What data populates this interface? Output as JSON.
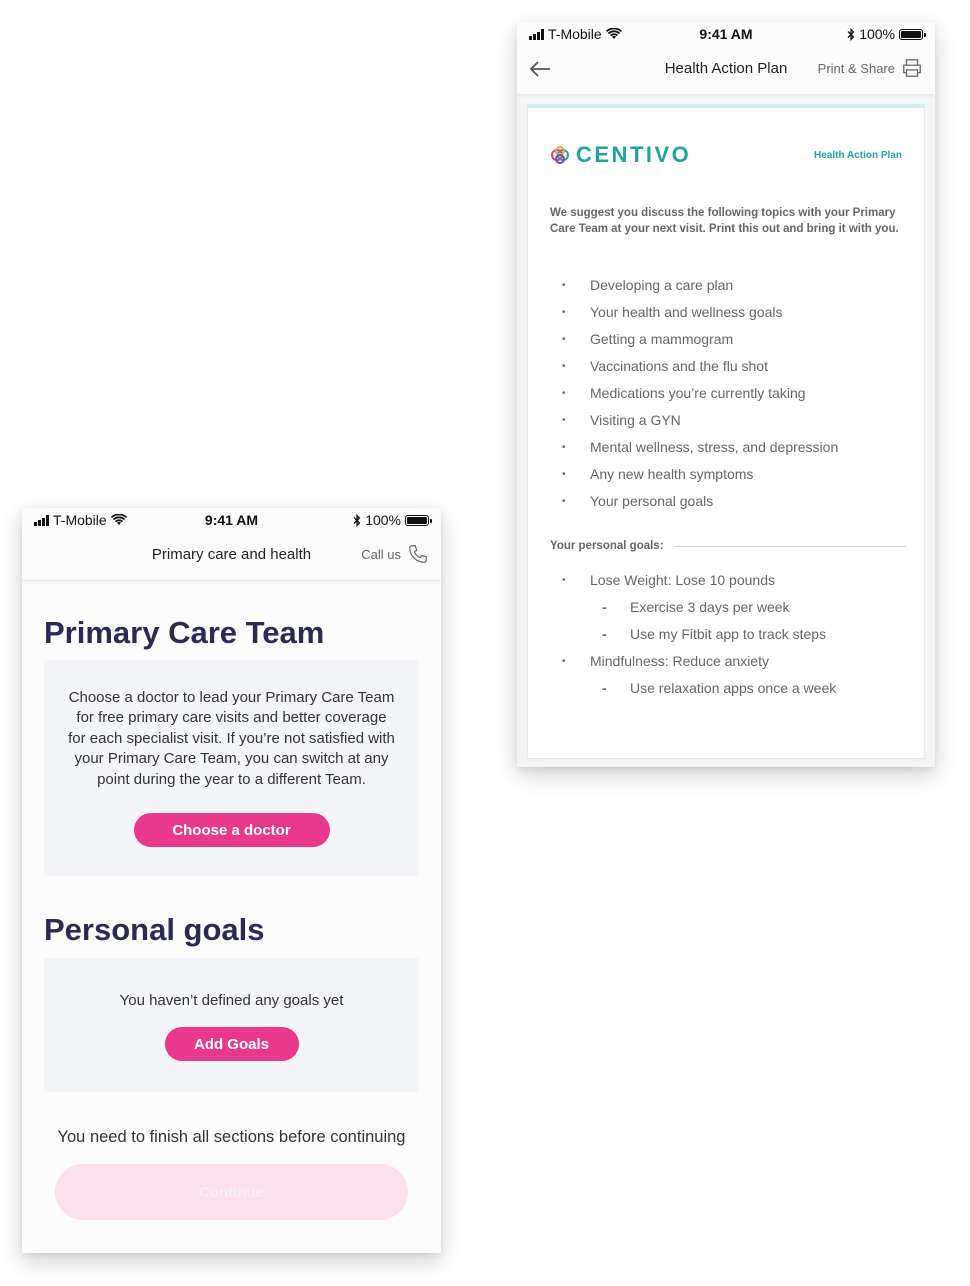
{
  "left_screen": {
    "status": {
      "carrier": "T-Mobile",
      "time": "9:41 AM",
      "battery": "100%"
    },
    "nav": {
      "title": "Primary care and health",
      "call_label": "Call us"
    },
    "primary_care": {
      "heading": "Primary Care Team",
      "description": "Choose a doctor to lead your Primary Care Team for free primary care visits and better coverage for each specialist visit. If you’re not satisfied with your Primary Care Team, you can switch at any point during the year to a different Team.",
      "button_label": "Choose a doctor"
    },
    "personal_goals": {
      "heading": "Personal goals",
      "empty_text": "You haven’t defined any goals yet",
      "button_label": "Add Goals"
    },
    "footer_note": "You need to finish all sections before continuing",
    "continue_label": "Continue"
  },
  "right_screen": {
    "status": {
      "carrier": "T-Mobile",
      "time": "9:41 AM",
      "battery": "100%"
    },
    "nav": {
      "title": "Health Action Plan",
      "print_label": "Print & Share"
    },
    "document": {
      "brand": "CENTIVO",
      "tag": "Health Action Plan",
      "intro": "We suggest you discuss the following topics with your Primary Care Team at your next visit. Print this out and bring it with you.",
      "topics": [
        "Developing a care plan",
        "Your health and wellness goals",
        "Getting a mammogram",
        "Vaccinations and the flu shot",
        "Medications you’re currently taking",
        "Visiting a GYN",
        "Mental wellness, stress, and depression",
        "Any new health symptoms",
        "Your personal goals"
      ],
      "goals_heading": "Your personal goals:",
      "goals": [
        "Lose Weight: Lose 10 pounds",
        "Exercise 3 days per week",
        "Use my Fitbit app to track steps",
        "Mindfulness: Reduce anxiety",
        "Use relaxation apps once a week"
      ]
    }
  },
  "colors": {
    "accent": "#e8398a",
    "heading": "#2c2a55",
    "brand": "#20a39f"
  }
}
